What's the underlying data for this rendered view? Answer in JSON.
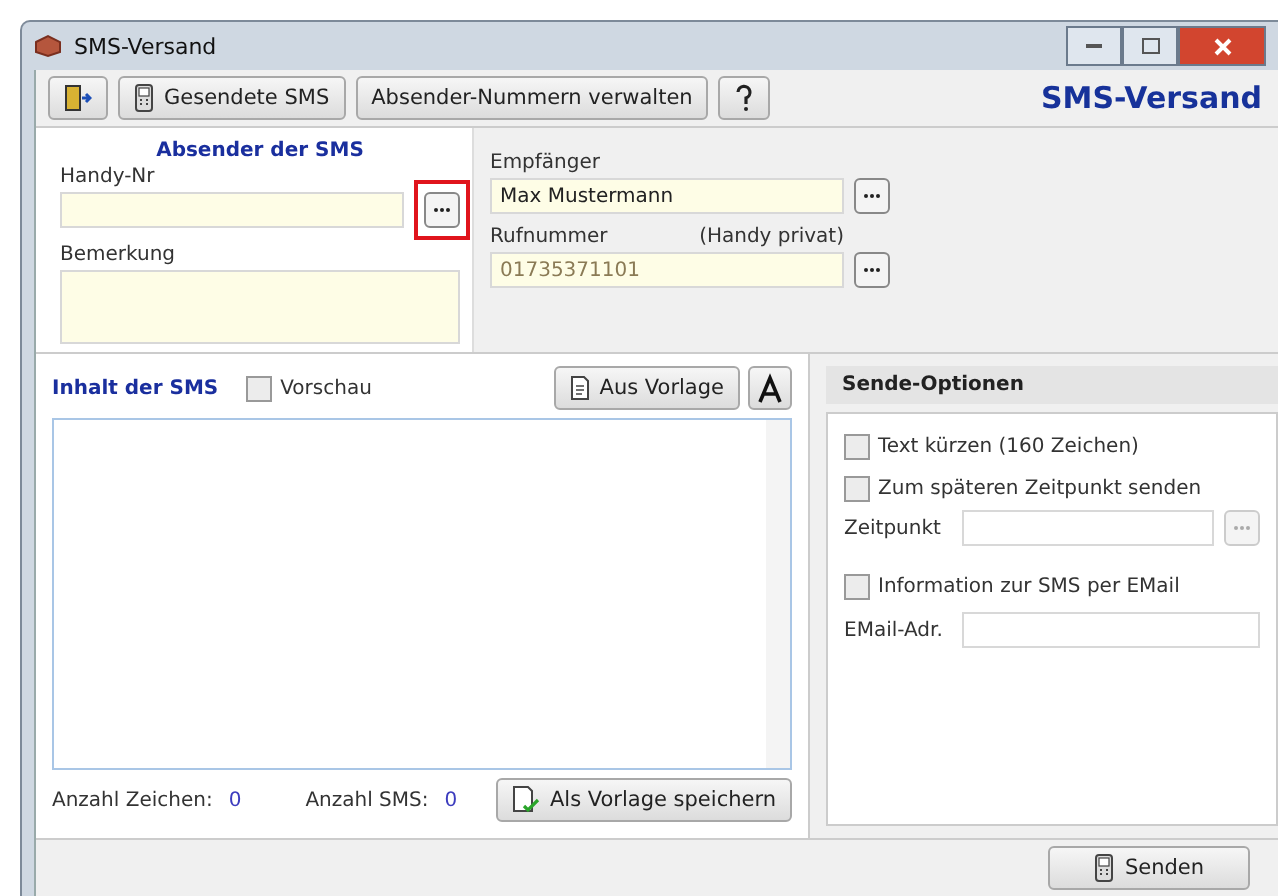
{
  "window": {
    "title": "SMS-Versand"
  },
  "toolbar": {
    "buttons": [
      {
        "kind": "icon"
      },
      {
        "kind": "text",
        "label": "Gesendete SMS"
      },
      {
        "kind": "plain",
        "label": "Absender-Nummern verwalten"
      },
      {
        "kind": "help"
      }
    ],
    "heading": "SMS-Versand"
  },
  "sender": {
    "title": "Absender der SMS",
    "phone_label": "Handy-Nr",
    "note_label": "Bemerkung",
    "highlighted": true
  },
  "recipient": {
    "label": "Empfänger",
    "value": "Max Mustermann",
    "phone_label": "Rufnummer",
    "phone_type": "(Handy privat)",
    "phone_value": "01735371101"
  },
  "content": {
    "title": "Inhalt der SMS",
    "preview": {
      "label": "Vorschau",
      "checked": false
    },
    "template_button": "Aus Vorlage",
    "count_chars_label": "Anzahl Zeichen:",
    "count_chars": "0",
    "count_sms_label": "Anzahl SMS:",
    "count_sms": "0",
    "save_button": "Als Vorlage speichern"
  },
  "options": {
    "title": "Sende-Optionen",
    "shorten": {
      "label": "Text kürzen (160 Zeichen)",
      "checked": false
    },
    "later": {
      "label": "Zum späteren Zeitpunkt senden",
      "checked": false
    },
    "time_label": "Zeitpunkt",
    "email_info": {
      "label": "Information zur SMS per EMail",
      "checked": false
    },
    "email_label": "EMail-Adr."
  },
  "send_button": "Senden"
}
